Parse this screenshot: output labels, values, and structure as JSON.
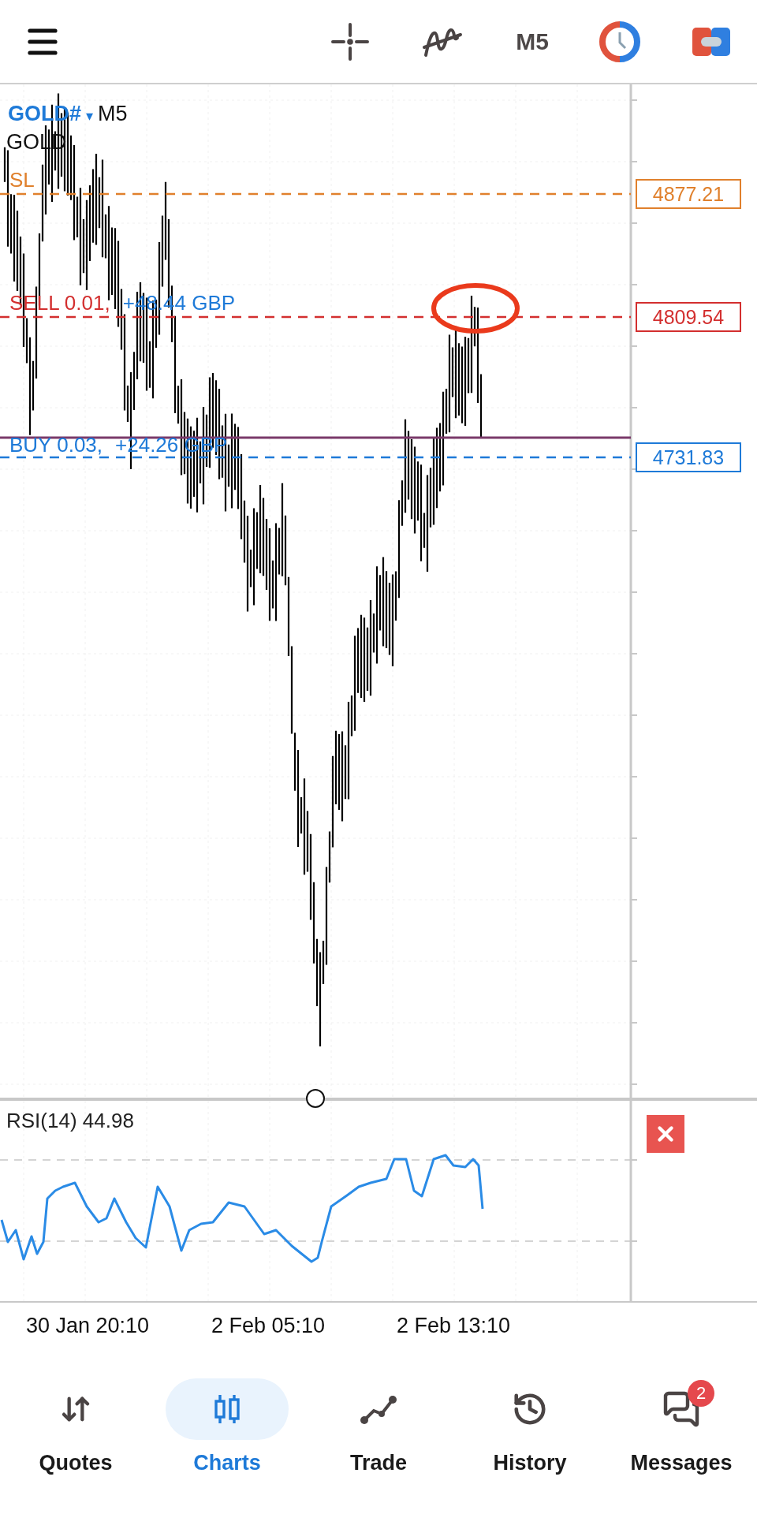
{
  "toolbar": {
    "timeframe": "M5"
  },
  "chart": {
    "symbol": "GOLD#",
    "symbol_caret": "▾",
    "period": "M5",
    "description": "GOLD",
    "price_lines": [
      {
        "kind": "stop",
        "label": "SL",
        "price": "4877.21",
        "color": "#e0802c"
      },
      {
        "kind": "order",
        "label": "SELL 0.01,",
        "profit": "+48.44 GBP",
        "price": "4809.54",
        "color": "#d32f2f"
      },
      {
        "kind": "order",
        "label": "BUY 0.03,",
        "profit": "+24.26 GBP",
        "price": "4731.83",
        "color": "#1e7ad8"
      }
    ]
  },
  "indicator": {
    "label": "RSI(14) 44.98"
  },
  "time_axis": [
    "30 Jan 20:10",
    "2 Feb 05:10",
    "2 Feb 13:10"
  ],
  "nav": [
    {
      "kind": "quotes",
      "label": "Quotes",
      "selected": false
    },
    {
      "kind": "charts",
      "label": "Charts",
      "selected": true
    },
    {
      "kind": "trade",
      "label": "Trade",
      "selected": false
    },
    {
      "kind": "history",
      "label": "History",
      "selected": false
    },
    {
      "kind": "messages",
      "label": "Messages",
      "selected": false,
      "badge": "2"
    }
  ]
}
